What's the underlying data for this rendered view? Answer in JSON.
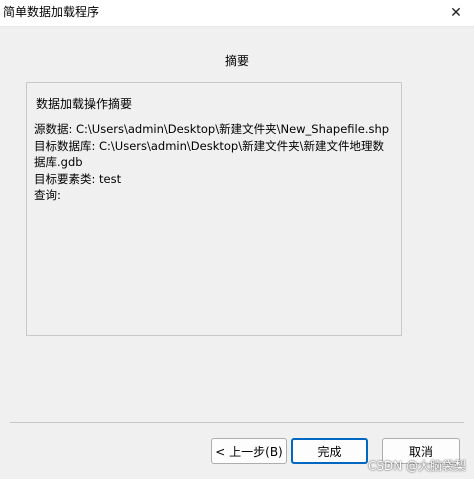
{
  "window": {
    "title": "简单数据加载程序",
    "close_glyph": "✕"
  },
  "page": {
    "heading": "摘要"
  },
  "summary": {
    "group_label": "数据加载操作摘要",
    "text": "源数据: C:\\Users\\admin\\Desktop\\新建文件夹\\New_Shapefile.shp\n目标数据库: C:\\Users\\admin\\Desktop\\新建文件夹\\新建文件地理数据库.gdb\n目标要素类: test\n查询:"
  },
  "buttons": {
    "back": "< 上一步(B)",
    "finish": "完成",
    "cancel": "取消"
  },
  "watermark": "CSDN @大脑袋梨",
  "colors": {
    "focus_border": "#0067c0",
    "background": "#f0f0f0"
  }
}
